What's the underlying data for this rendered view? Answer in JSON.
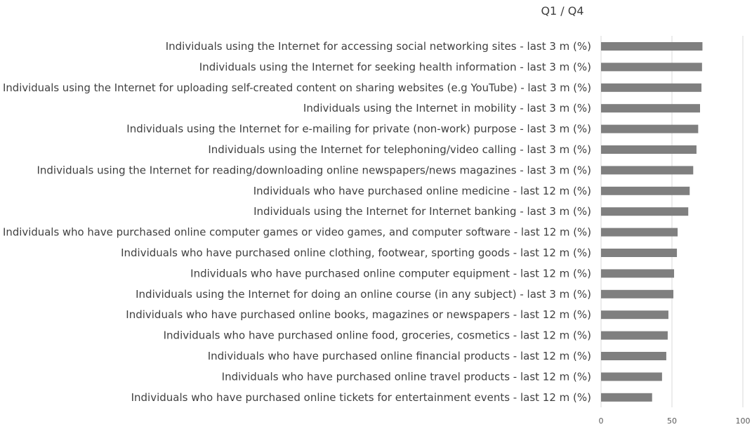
{
  "chart_data": {
    "type": "bar",
    "orientation": "horizontal",
    "title": "Q1 / Q4",
    "categories": [
      "Individuals using the Internet for accessing social networking sites - last 3 m (%)",
      "Individuals using the Internet for seeking health information - last 3 m (%)",
      "Individuals using the Internet for uploading self-created content on sharing websites (e.g YouTube) - last 3 m (%)",
      "Individuals using the Internet in mobility - last 3 m (%)",
      "Individuals using the Internet for e-mailing for private (non-work) purpose - last 3 m (%)",
      "Individuals using the Internet for telephoning/video calling - last 3 m (%)",
      "Individuals using the Internet for reading/downloading online newspapers/news magazines - last 3 m (%)",
      "Individuals who have purchased online medicine - last 12 m (%)",
      "Individuals using the Internet for Internet banking - last 3 m (%)",
      "Individuals who have purchased online computer games or video games, and computer software - last 12 m (%)",
      "Individuals who have purchased online clothing, footwear, sporting goods - last 12 m (%)",
      "Individuals who have purchased online computer equipment - last 12 m (%)",
      "Individuals using the Internet for doing an online course (in any subject) - last 3 m (%)",
      "Individuals who have purchased online books, magazines or newspapers - last 12 m (%)",
      "Individuals who have purchased online food, groceries, cosmetics - last 12 m (%)",
      "Individuals who have purchased online financial products - last 12 m (%)",
      "Individuals who have purchased online travel products - last 12 m (%)",
      "Individuals who have purchased online tickets for entertainment events - last 12 m (%)"
    ],
    "values": [
      71.5,
      71.2,
      70.8,
      69.8,
      68.5,
      67.3,
      65.0,
      62.5,
      61.5,
      54.0,
      53.5,
      51.5,
      51.0,
      47.5,
      47.0,
      46.0,
      43.0,
      36.0
    ],
    "xlim": [
      0,
      100
    ],
    "xticks": [
      "0",
      "50",
      "100"
    ],
    "xlabel": "",
    "ylabel": "",
    "gridlines": true,
    "legend": "none",
    "bar_color": "#7f7f7f",
    "grid_color": "#d9d9d9"
  }
}
